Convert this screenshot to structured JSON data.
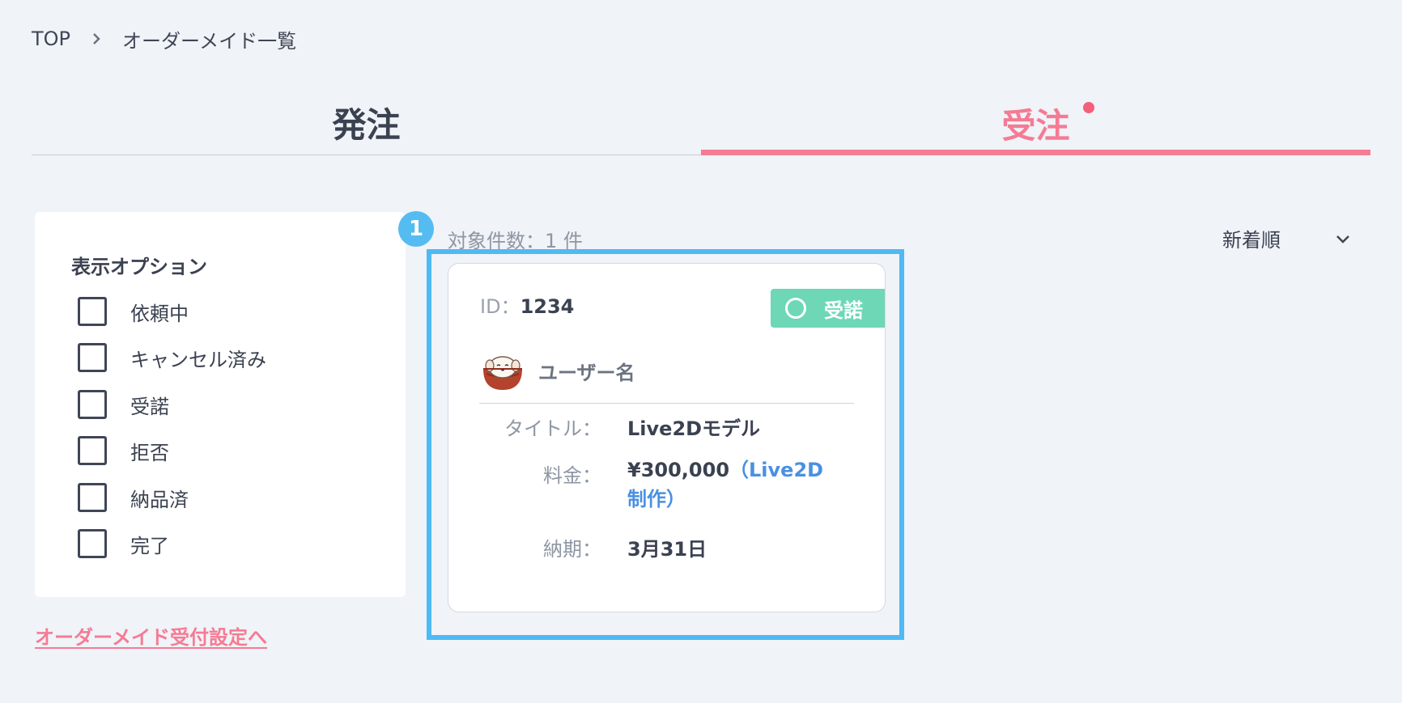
{
  "breadcrumb": {
    "home": "TOP",
    "current": "オーダーメイド一覧"
  },
  "tabs": {
    "order": "発注",
    "receive": "受注"
  },
  "options": {
    "title": "表示オプション",
    "items": [
      "依頼中",
      "キャンセル済み",
      "受諾",
      "拒否",
      "納品済",
      "完了"
    ]
  },
  "settings_link": "オーダーメイド受付設定へ",
  "results": {
    "badge": "1",
    "count": "対象件数：1 件",
    "sort": "新着順"
  },
  "card": {
    "id_label": "ID：",
    "id_value": "1234",
    "status": "受諾",
    "username": "ユーザー名",
    "title_label": "タイトル：",
    "title_value": "Live2Dモデル",
    "price_label": "料金：",
    "price_value": "¥300,000",
    "price_note": "（Live2D制作）",
    "due_label": "納期：",
    "due_value": "3月31日"
  },
  "colors": {
    "accent": "#f57b94",
    "highlight": "#4fb9f4",
    "status": "#6ed7b6",
    "note": "#4a90e2"
  }
}
